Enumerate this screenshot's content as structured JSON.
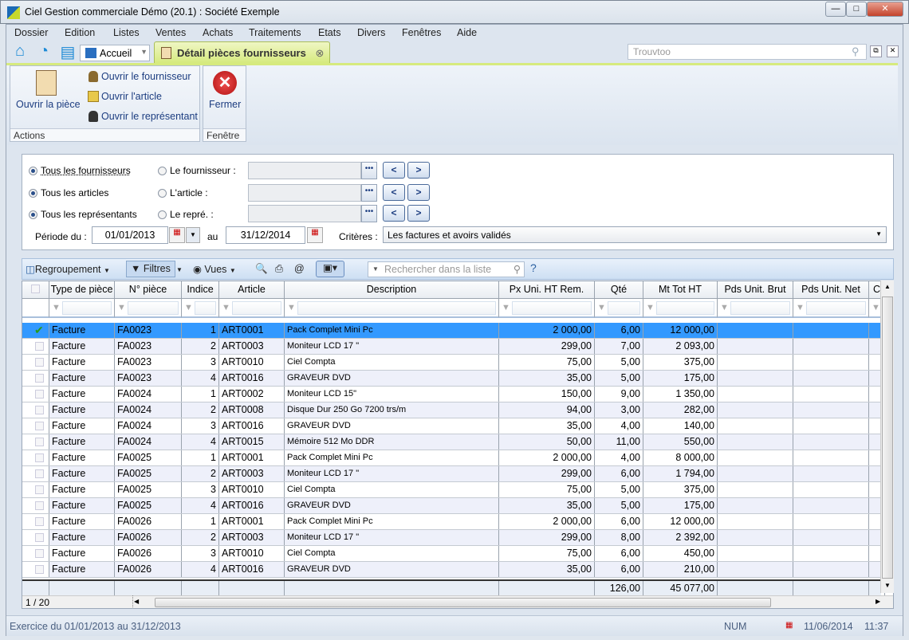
{
  "window": {
    "title": "Ciel Gestion commerciale Démo (20.1) : Société Exemple",
    "controls": [
      "minimize",
      "maximize",
      "close"
    ]
  },
  "menu": [
    "Dossier",
    "Edition",
    "Listes",
    "Ventes",
    "Achats",
    "Traitements",
    "Etats",
    "Divers",
    "Fenêtres",
    "Aide"
  ],
  "toolbar": {
    "accueil": "Accueil",
    "tab": "Détail pièces fournisseurs",
    "search_placeholder": "Trouvtoo"
  },
  "ribbon": {
    "open_piece": "Ouvrir la pièce",
    "open_supplier": "Ouvrir le fournisseur",
    "open_article": "Ouvrir l'article",
    "open_rep": "Ouvrir le représentant",
    "actions": "Actions",
    "close": "Fermer",
    "window": "Fenêtre"
  },
  "filters": {
    "all_suppliers": "Tous les fournisseurs",
    "supplier": "Le fournisseur :",
    "all_articles": "Tous les articles",
    "article": "L'article :",
    "all_reps": "Tous les représentants",
    "rep": "Le repré. :",
    "period_label": "Période du :",
    "date_from": "01/01/2013",
    "au": "au",
    "date_to": "31/12/2014",
    "criteria_label": "Critères :",
    "criteria": "Les factures et avoirs validés"
  },
  "grid_toolbar": {
    "grouping": "Regroupement",
    "filters": "Filtres",
    "views": "Vues",
    "search_placeholder": "Rechercher dans la liste",
    "help": "?"
  },
  "grid": {
    "columns": [
      "Type de pièce",
      "N° pièce",
      "Indice",
      "Article",
      "Description",
      "Px Uni. HT Rem.",
      "Qté",
      "Mt Tot HT",
      "Pds Unit. Brut",
      "Pds Unit. Net",
      "C"
    ],
    "rows": [
      [
        "Facture",
        "FA0023",
        "1",
        "ART0001",
        "Pack Complet Mini Pc",
        "2 000,00",
        "6,00",
        "12 000,00"
      ],
      [
        "Facture",
        "FA0023",
        "2",
        "ART0003",
        "Moniteur LCD 17 \"",
        "299,00",
        "7,00",
        "2 093,00"
      ],
      [
        "Facture",
        "FA0023",
        "3",
        "ART0010",
        "Ciel Compta",
        "75,00",
        "5,00",
        "375,00"
      ],
      [
        "Facture",
        "FA0023",
        "4",
        "ART0016",
        "GRAVEUR DVD",
        "35,00",
        "5,00",
        "175,00"
      ],
      [
        "Facture",
        "FA0024",
        "1",
        "ART0002",
        "Moniteur LCD 15\"",
        "150,00",
        "9,00",
        "1 350,00"
      ],
      [
        "Facture",
        "FA0024",
        "2",
        "ART0008",
        "Disque Dur 250 Go 7200 trs/m",
        "94,00",
        "3,00",
        "282,00"
      ],
      [
        "Facture",
        "FA0024",
        "3",
        "ART0016",
        "GRAVEUR DVD",
        "35,00",
        "4,00",
        "140,00"
      ],
      [
        "Facture",
        "FA0024",
        "4",
        "ART0015",
        "Mémoire 512 Mo DDR",
        "50,00",
        "11,00",
        "550,00"
      ],
      [
        "Facture",
        "FA0025",
        "1",
        "ART0001",
        "Pack Complet Mini Pc",
        "2 000,00",
        "4,00",
        "8 000,00"
      ],
      [
        "Facture",
        "FA0025",
        "2",
        "ART0003",
        "Moniteur LCD 17 \"",
        "299,00",
        "6,00",
        "1 794,00"
      ],
      [
        "Facture",
        "FA0025",
        "3",
        "ART0010",
        "Ciel Compta",
        "75,00",
        "5,00",
        "375,00"
      ],
      [
        "Facture",
        "FA0025",
        "4",
        "ART0016",
        "GRAVEUR DVD",
        "35,00",
        "5,00",
        "175,00"
      ],
      [
        "Facture",
        "FA0026",
        "1",
        "ART0001",
        "Pack Complet Mini Pc",
        "2 000,00",
        "6,00",
        "12 000,00"
      ],
      [
        "Facture",
        "FA0026",
        "2",
        "ART0003",
        "Moniteur LCD 17 \"",
        "299,00",
        "8,00",
        "2 392,00"
      ],
      [
        "Facture",
        "FA0026",
        "3",
        "ART0010",
        "Ciel Compta",
        "75,00",
        "6,00",
        "450,00"
      ],
      [
        "Facture",
        "FA0026",
        "4",
        "ART0016",
        "GRAVEUR DVD",
        "35,00",
        "6,00",
        "210,00"
      ]
    ],
    "selected_row": 0,
    "totals": {
      "qty": "126,00",
      "amount": "45 077,00"
    },
    "pager": "1 / 20"
  },
  "status": {
    "exercise": "Exercice du 01/01/2013 au 31/12/2013",
    "num": "NUM",
    "date": "11/06/2014",
    "time": "11:37"
  },
  "colors": {
    "selection": "#3399ff",
    "tab": "#d6ea7e",
    "alt_row": "#eef0fa"
  }
}
